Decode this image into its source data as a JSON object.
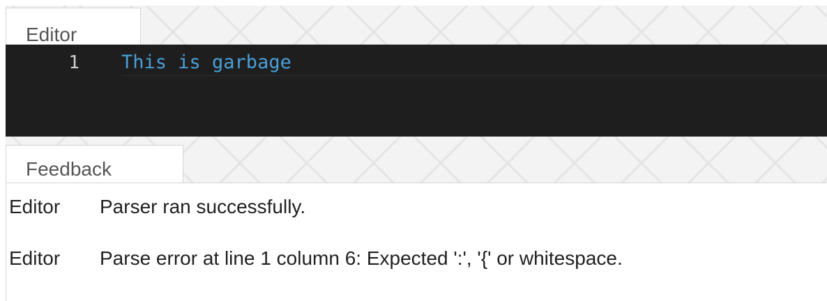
{
  "editor_panel": {
    "tab_label": "Editor",
    "lines": [
      {
        "number": "1",
        "text": "This is garbage"
      }
    ]
  },
  "feedback_panel": {
    "tab_label": "Feedback",
    "messages": [
      {
        "source": "Editor",
        "text": "Parser ran successfully."
      },
      {
        "source": "Editor",
        "text": "Parse error at line 1 column 6: Expected ':', '{' or whitespace."
      }
    ]
  },
  "colors": {
    "editor_background": "#1e1e1e",
    "code_text": "#4a9fd8",
    "line_number": "#d0d0d0"
  }
}
